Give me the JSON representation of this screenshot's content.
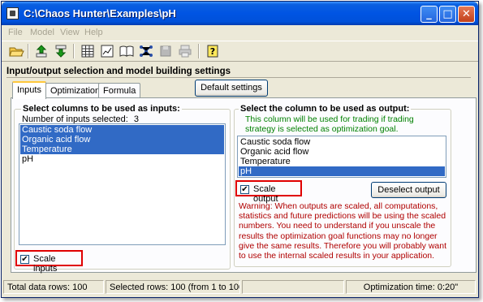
{
  "window": {
    "title": "C:\\Chaos Hunter\\Examples\\pH",
    "minimize_glyph": "_",
    "maximize_glyph": "□",
    "close_glyph": "✕"
  },
  "menu": [
    "File",
    "Model",
    "View",
    "Help"
  ],
  "toolbar": {
    "icons": [
      "open-folder-icon",
      "upload-icon",
      "download-icon",
      "grid-icon",
      "chart-icon",
      "book-icon",
      "network-icon",
      "save-disk-icon",
      "print-icon",
      "help-icon"
    ]
  },
  "group_title": "Input/output selection and model building settings",
  "tabs": [
    "Inputs",
    "Optimization",
    "Formula"
  ],
  "default_settings_label": "Default settings",
  "inputs_panel": {
    "title": "Select columns to be used as inputs:",
    "count_label": "Number of inputs selected:",
    "count_value": "3",
    "items": [
      {
        "label": "Caustic soda flow",
        "selected": true
      },
      {
        "label": "Organic acid flow",
        "selected": true
      },
      {
        "label": "Temperature",
        "selected": true
      },
      {
        "label": "pH",
        "selected": false
      }
    ],
    "scale_label": "Scale inputs",
    "scale_checked": true
  },
  "output_panel": {
    "title": "Select the column to be used as output:",
    "note": "This column will be used for trading if trading strategy is selected as optimization goal.",
    "items": [
      {
        "label": "Caustic soda flow",
        "selected": false
      },
      {
        "label": "Organic acid flow",
        "selected": false
      },
      {
        "label": "Temperature",
        "selected": false
      },
      {
        "label": "pH",
        "selected": true
      }
    ],
    "scale_label": "Scale output",
    "scale_checked": true,
    "deselect_label": "Deselect output",
    "warning": "Warning: When outputs are scaled, all computations, statistics and future predictions will be using the scaled numbers. You need to understand if you unscale the results the optimization goal functions may no longer give the same results. Therefore you will probably want to use the internal scaled results in your application."
  },
  "status": {
    "total_rows": "Total data rows: 100",
    "selected_rows": "Selected rows: 100  (from 1 to 100)",
    "middle_blank": "",
    "optimization_time": "Optimization time: 0:20\""
  }
}
